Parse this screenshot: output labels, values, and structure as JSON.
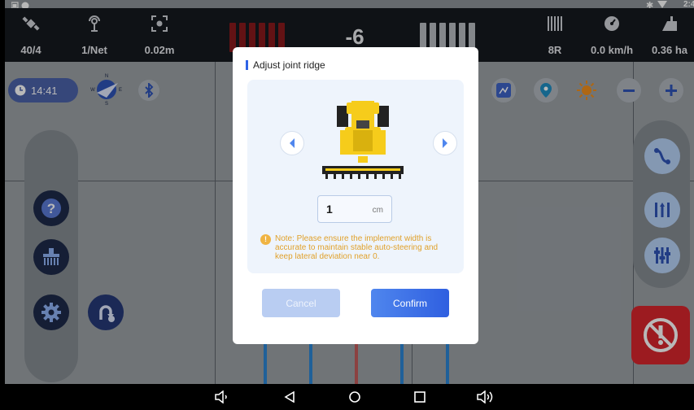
{
  "status": {
    "clock": "2:4"
  },
  "topbar": {
    "stats_left": [
      {
        "icon": "satellite-icon",
        "value": "40/4"
      },
      {
        "icon": "network-signal-icon",
        "value": "1/Net"
      },
      {
        "icon": "precision-target-icon",
        "value": "0.02m"
      }
    ],
    "deviation": "-6",
    "stats_right": [
      {
        "icon": "implement-rows-icon",
        "value": "8R"
      },
      {
        "icon": "speedometer-icon",
        "value": "0.0 km/h"
      },
      {
        "icon": "area-icon",
        "value": "0.36 ha"
      }
    ]
  },
  "map": {
    "clock_time": "14:41",
    "compass_labels": {
      "n": "N",
      "s": "S",
      "w": "W",
      "e": "E"
    }
  },
  "dialog": {
    "title": "Adjust joint ridge",
    "width_value": "1",
    "width_unit": "cm",
    "note": "Note: Please ensure the implement width is accurate to maintain stable auto-steering and keep lateral deviation near 0.",
    "cancel_label": "Cancel",
    "confirm_label": "Confirm"
  },
  "colors": {
    "accent": "#2e63e6",
    "warning": "#e0a12b",
    "emergency": "#d9262d",
    "tractor": "#f6cc1b"
  }
}
